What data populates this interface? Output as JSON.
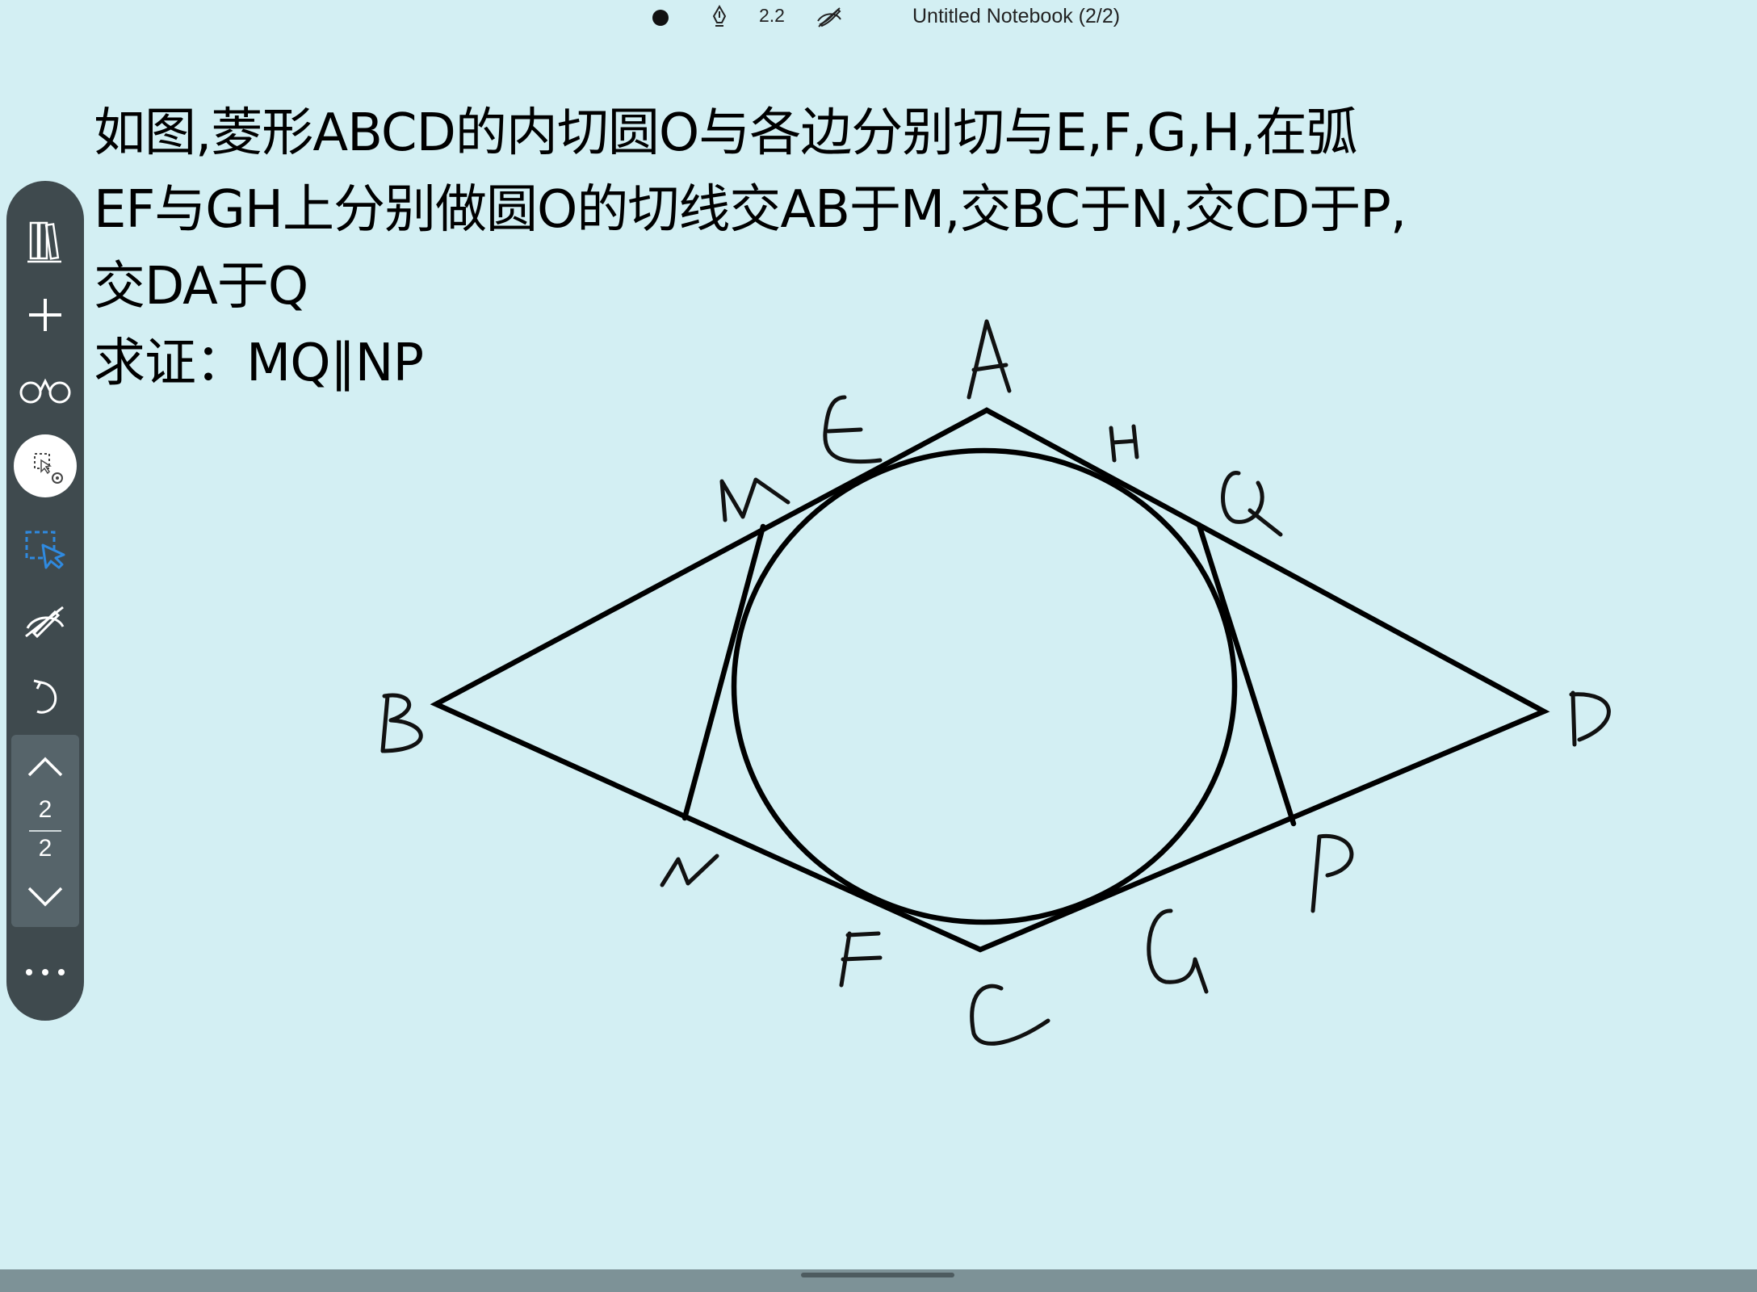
{
  "topbar": {
    "pen_size": "2.2",
    "notebook_title": "Untitled Notebook (2/2)"
  },
  "problem": {
    "line1": "如图,菱形ABCD的内切圆O与各边分别切与E,F,G,H,在弧",
    "line2": "EF与GH上分别做圆O的切线交AB于M,交BC于N,交CD于P,",
    "line3": "交DA于Q",
    "line4": "求证：MQ∥NP"
  },
  "sidebar": {
    "icons": [
      "library-icon",
      "add-page-icon",
      "reading-mode-icon",
      "lasso-settings-icon",
      "lasso-select-icon",
      "hide-handwriting-icon",
      "undo-icon"
    ],
    "page_current": "2",
    "page_total": "2"
  },
  "figure": {
    "point_labels": [
      "A",
      "B",
      "C",
      "D",
      "E",
      "F",
      "G",
      "H",
      "M",
      "N",
      "P",
      "Q"
    ]
  },
  "colors": {
    "background": "#d3eff3",
    "sidebar": "#3f4a4e",
    "lasso_accent": "#2f8ae0"
  }
}
